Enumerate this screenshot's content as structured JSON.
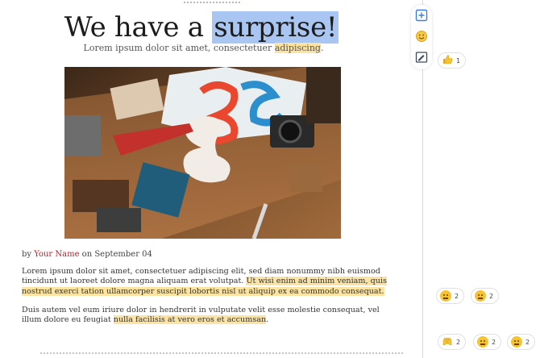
{
  "document": {
    "title_before": "We have a ",
    "title_selected": "surprise!",
    "subtitle_before": "Lorem ipsum dolor sit amet, consectetuer ",
    "subtitle_highlight": "adipiscing",
    "subtitle_after": ".",
    "byline_prefix": "by ",
    "author": "Your Name",
    "byline_suffix": " on September 04",
    "para1_normal": "Lorem ipsum dolor sit amet, consectetuer adipiscing elit, sed diam nonummy nibh euismod tincidunt ut laoreet dolore magna aliquam erat volutpat. ",
    "para1_highlight": "Ut wisi enim ad minim veniam, quis nostrud exerci tation ullamcorper suscipit lobortis nisl ut aliquip ex ea commodo consequat.",
    "para2_normal": "Duis autem vel eum iriure dolor in hendrerit in vulputate velit esse molestie consequat, vel illum dolore eu feugiat ",
    "para2_highlight": "nulla facilisis at vero eros et accumsan",
    "para2_end": "."
  },
  "toolbar": {
    "tools": [
      "add-comment-icon",
      "emoji-icon",
      "suggest-edit-icon"
    ]
  },
  "reactions": {
    "thumbs_up": {
      "icon": "thumbs-up-emoji",
      "count": "1"
    },
    "thinking": {
      "icon": "thinking-face-emoji",
      "count": "2"
    },
    "neutral": {
      "icon": "neutral-face-emoji",
      "count": "2"
    },
    "bottom": [
      {
        "icon": "raised-hands-emoji",
        "count": "2"
      },
      {
        "icon": "party-face-emoji",
        "count": "2"
      },
      {
        "icon": "thinking-face-emoji",
        "count": "2"
      }
    ]
  },
  "colors": {
    "selection": "#a9c6f2",
    "highlight": "#fbe3a2",
    "author": "#b5232a"
  }
}
